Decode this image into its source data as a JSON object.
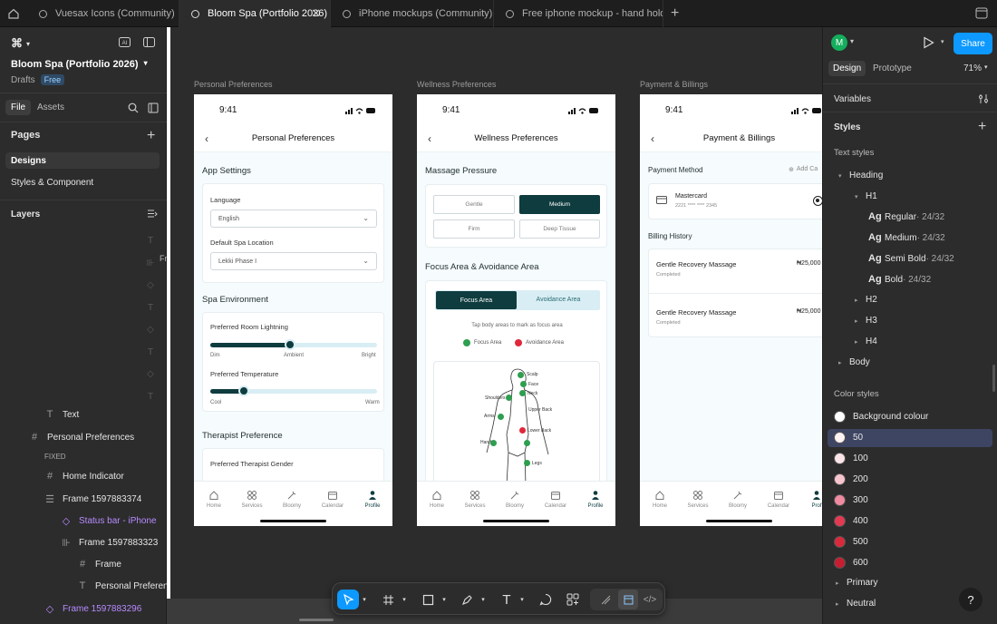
{
  "tabs": [
    {
      "label": "Vuesax Icons (Community)"
    },
    {
      "label": "Bloom Spa (Portfolio 2026)"
    },
    {
      "label": "iPhone mockups (Community)"
    },
    {
      "label": "Free iphone mockup - hand holding iP"
    }
  ],
  "left_panel": {
    "file_name": "Bloom Spa (Portfolio 2026)",
    "drafts": "Drafts",
    "plan_badge": "Free",
    "file_tab": "File",
    "assets_tab": "Assets",
    "pages_title": "Pages",
    "pages": [
      "Designs",
      "Styles & Component"
    ],
    "layers_title": "Layers",
    "layers": [
      {
        "label": "Text",
        "icon": "text-icon"
      },
      {
        "label": "Personal Preferences",
        "icon": "frame-icon"
      },
      {
        "label": "FIXED",
        "icon": ""
      },
      {
        "label": "Home Indicator",
        "icon": "frame-icon"
      },
      {
        "label": "Frame 1597883374",
        "icon": "autolayout-icon"
      },
      {
        "label": "Status bar - iPhone",
        "icon": "component-instance-icon"
      },
      {
        "label": "Frame 1597883323",
        "icon": "autolayout-horizontal-icon"
      },
      {
        "label": "Frame",
        "icon": "frame-icon"
      },
      {
        "label": "Personal Preferences",
        "icon": "text-icon"
      },
      {
        "label": "Frame 1597883296",
        "icon": "component-instance-icon"
      }
    ],
    "stray_label": "Fr"
  },
  "frames": {
    "personal": {
      "frame_label": "Personal Preferences",
      "time": "9:41",
      "title": "Personal Preferences",
      "app_settings": "App Settings",
      "language_label": "Language",
      "language_value": "English",
      "location_label": "Default Spa Location",
      "location_value": "Lekki Phase I",
      "spa_env": "Spa Environment",
      "lighting_label": "Preferred Room Lightning",
      "lighting_ticks": [
        "Dim",
        "Ambient",
        "Bright"
      ],
      "lighting_level": 0.48,
      "temp_label": "Preferred Temperature",
      "temp_ticks": [
        "Cool",
        "Warm"
      ],
      "temp_level": 0.2,
      "therapist": "Therapist Preference",
      "gender_label": "Preferred Therapist Gender"
    },
    "wellness": {
      "frame_label": "Wellness Preferences",
      "time": "9:41",
      "title": "Wellness Preferences",
      "pressure_title": "Massage Pressure",
      "pressure_options": [
        "Gentle",
        "Medium",
        "Firm",
        "Deep Tissue"
      ],
      "pressure_selected": "Medium",
      "focus_title": "Focus Area & Avoidance Area",
      "focus_tab": "Focus Area",
      "avoid_tab": "Avoidance Area",
      "hint": "Tap body areas to mark as focus area",
      "legend_focus": "Focus Area",
      "legend_avoid": "Avoidance Area",
      "body_labels": [
        "Scalp",
        "Face",
        "Neck",
        "Shoulders",
        "Upper Back",
        "Arms",
        "Lower Back",
        "Hand",
        "Legs"
      ]
    },
    "payment": {
      "frame_label": "Payment & Billings",
      "time": "9:41",
      "title": "Payment & Billings",
      "method_title": "Payment Method",
      "add_card": "Add Ca",
      "card_name": "Mastercard",
      "card_number": "2221 **** **** 2345",
      "billing_title": "Billing History",
      "bills": [
        {
          "name": "Gentle Recovery Massage",
          "status": "Completed",
          "amount": "₦25,000"
        },
        {
          "name": "Gentle Recovery Massage",
          "status": "Completed",
          "amount": "₦25,000"
        }
      ]
    }
  },
  "nav": [
    "Home",
    "Services",
    "Bloomy",
    "Calendar",
    "Profile"
  ],
  "nav_payment_last": "Prof",
  "right_panel": {
    "avatar": "M",
    "share": "Share",
    "design_tab": "Design",
    "prototype_tab": "Prototype",
    "zoom": "71%",
    "variables": "Variables",
    "styles": "Styles",
    "text_styles": "Text styles",
    "heading": "Heading",
    "h1": "H1",
    "weights": [
      {
        "label": "Regular",
        "spec": " · 24/32"
      },
      {
        "label": "Medium",
        "spec": " · 24/32"
      },
      {
        "label": "Semi Bold",
        "spec": " · 24/32"
      },
      {
        "label": "Bold",
        "spec": " · 24/32"
      }
    ],
    "ag": "Ag",
    "other_headings": [
      "H2",
      "H3",
      "H4"
    ],
    "body": "Body",
    "color_styles": "Color styles",
    "colors": [
      {
        "label": "Background colour",
        "hex": "#ffffff"
      },
      {
        "label": "50",
        "hex": "#fdf2f4"
      },
      {
        "label": "100",
        "hex": "#fce4e8"
      },
      {
        "label": "200",
        "hex": "#f8c5cf"
      },
      {
        "label": "300",
        "hex": "#f08aa0"
      },
      {
        "label": "400",
        "hex": "#e33a52"
      },
      {
        "label": "500",
        "hex": "#d92a3c"
      },
      {
        "label": "600",
        "hex": "#c41e30"
      }
    ],
    "groups": [
      "Primary",
      "Neutral"
    ],
    "help": "?"
  },
  "colors": {
    "accent": "#0d99ff",
    "brand": "#0f3c3f",
    "avatar": "#14ae5c",
    "focus": "#2e9e4f",
    "avoid": "#e0283a"
  }
}
